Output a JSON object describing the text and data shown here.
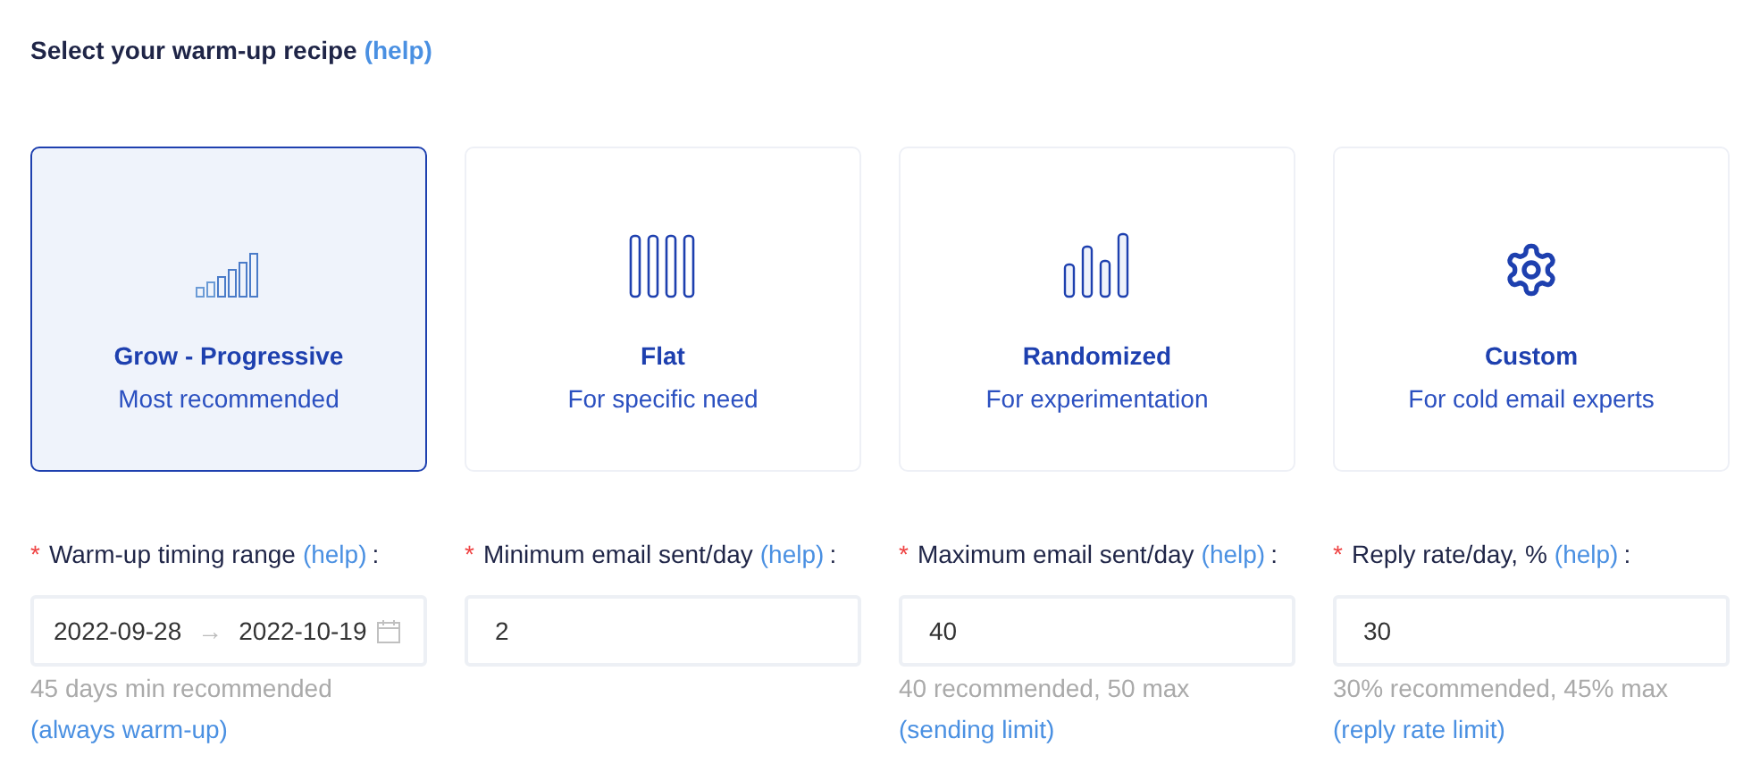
{
  "heading": {
    "text": "Select your warm-up recipe",
    "help": "(help)"
  },
  "recipes": [
    {
      "kind": "progressive",
      "title": "Grow - Progressive",
      "subtitle": "Most recommended",
      "selected": true
    },
    {
      "kind": "flat",
      "title": "Flat",
      "subtitle": "For specific need",
      "selected": false
    },
    {
      "kind": "random",
      "title": "Randomized",
      "subtitle": "For experimentation",
      "selected": false
    },
    {
      "kind": "custom",
      "title": "Custom",
      "subtitle": "For cold email experts",
      "selected": false
    }
  ],
  "fields": [
    {
      "kind": "date_range",
      "required_mark": "*",
      "label": "Warm-up timing range",
      "help": "(help)",
      "suffix": ":",
      "start": "2022-09-28",
      "separator": "→",
      "end": "2022-10-19",
      "hint": "45 days min recommended",
      "hint_link": "(always warm-up)"
    },
    {
      "kind": "number",
      "required_mark": "*",
      "label": "Minimum email sent/day",
      "help": "(help)",
      "suffix": ":",
      "value": "2"
    },
    {
      "kind": "number",
      "required_mark": "*",
      "label": "Maximum email sent/day",
      "help": "(help)",
      "suffix": ":",
      "value": "40",
      "hint": "40 recommended, 50 max",
      "hint_link": "(sending limit)"
    },
    {
      "kind": "number",
      "required_mark": "*",
      "label": "Reply rate/day, %",
      "help": "(help)",
      "suffix": ":",
      "value": "30",
      "hint": "30% recommended, 45% max",
      "hint_link": "(reply rate limit)"
    }
  ]
}
